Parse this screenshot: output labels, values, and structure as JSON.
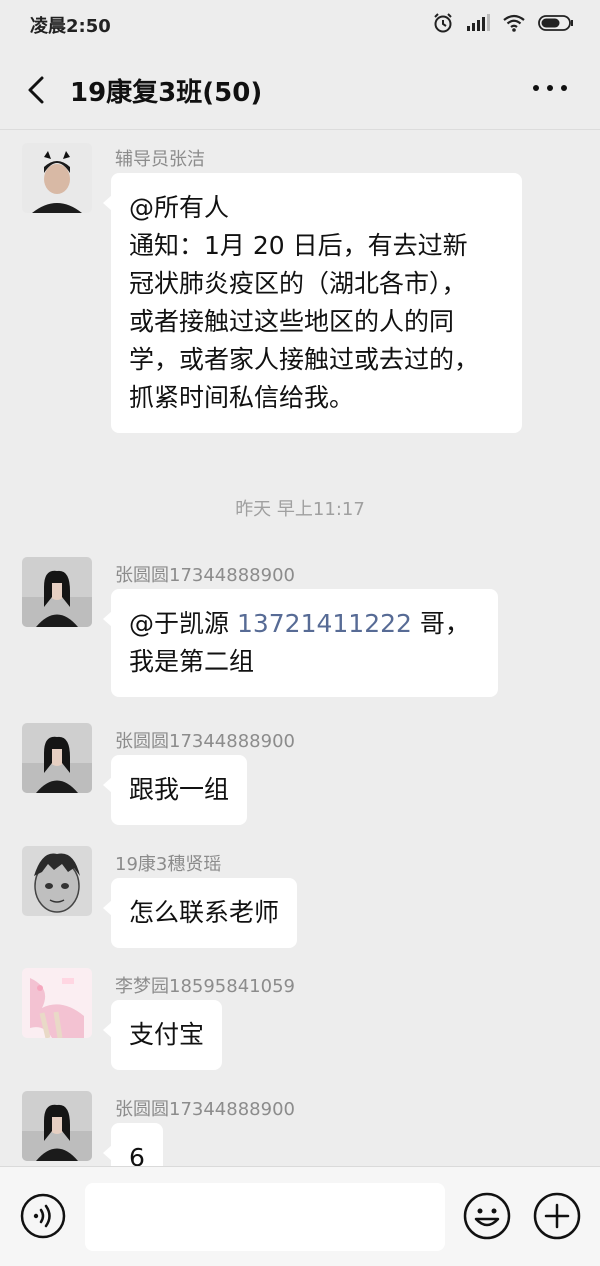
{
  "status_bar": {
    "time": "凌晨2:50"
  },
  "nav": {
    "title": "19康复3班(50)"
  },
  "time_divider": "昨天 早上11:17",
  "messages": [
    {
      "sender": "辅导员张洁",
      "lines": [
        "@所有人",
        "通知：1月 20 日后，有去过新",
        "冠状肺炎疫区的（湖北各市），",
        "或者接触过这些地区的人的同",
        "学，或者家人接触过或去过的，",
        "抓紧时间私信给我。"
      ]
    },
    {
      "sender": "张圆圆17344888900",
      "prefix": "@于凯源 ",
      "phone": "13721411222",
      "suffix": " 哥，",
      "line2": "我是第二组"
    },
    {
      "sender": "张圆圆17344888900",
      "text": "跟我一组"
    },
    {
      "sender": "19康3穗贤瑶",
      "text": "怎么联系老师"
    },
    {
      "sender": "李梦园18595841059",
      "text": "支付宝"
    },
    {
      "sender": "张圆圆17344888900",
      "text": "6"
    }
  ],
  "icons": {
    "alarm": "alarm-icon",
    "signal": "signal-icon",
    "wifi": "wifi-icon",
    "battery": "battery-icon",
    "back": "back-icon",
    "more": "more-icon",
    "voice": "voice-icon",
    "emoji": "emoji-icon",
    "add": "add-icon"
  },
  "colors": {
    "background": "#ededed",
    "bubble": "#ffffff",
    "link": "#576b95",
    "meta_text": "#8c8c8c"
  }
}
